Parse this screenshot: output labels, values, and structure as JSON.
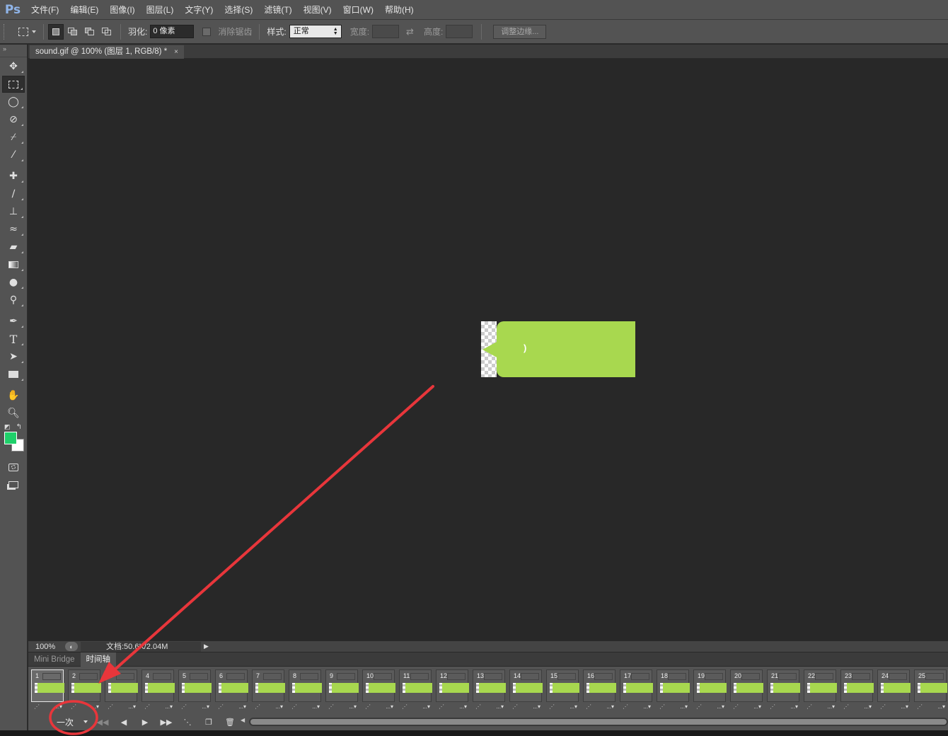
{
  "app": {
    "logo": "Ps"
  },
  "menu": [
    "文件(F)",
    "编辑(E)",
    "图像(I)",
    "图层(L)",
    "文字(Y)",
    "选择(S)",
    "滤镜(T)",
    "视图(V)",
    "窗口(W)",
    "帮助(H)"
  ],
  "options": {
    "feather_label": "羽化:",
    "feather_value": "0 像素",
    "antialias_label": "消除锯齿",
    "style_label": "样式:",
    "style_value": "正常",
    "width_label": "宽度:",
    "height_label": "高度:",
    "refine_edge": "调整边缘..."
  },
  "document": {
    "tab_title": "sound.gif @ 100% (图层 1, RGB/8) *",
    "close_glyph": "×",
    "bubble_glyph": ")"
  },
  "status": {
    "zoom": "100%",
    "docinfo": "文档:50.6K/2.04M"
  },
  "panel_tabs": [
    "Mini Bridge",
    "时间轴"
  ],
  "frames": [
    {
      "num": "1",
      "delay": "..."
    },
    {
      "num": "2",
      "delay": "..."
    },
    {
      "num": "3",
      "delay": "..."
    },
    {
      "num": "4",
      "delay": "..."
    },
    {
      "num": "5",
      "delay": "..."
    },
    {
      "num": "6",
      "delay": "..."
    },
    {
      "num": "7",
      "delay": "..."
    },
    {
      "num": "8",
      "delay": "..."
    },
    {
      "num": "9",
      "delay": "..."
    },
    {
      "num": "10",
      "delay": "..."
    },
    {
      "num": "11",
      "delay": "..."
    },
    {
      "num": "12",
      "delay": "..."
    },
    {
      "num": "13",
      "delay": "..."
    },
    {
      "num": "14",
      "delay": "..."
    },
    {
      "num": "15",
      "delay": "..."
    },
    {
      "num": "16",
      "delay": "..."
    },
    {
      "num": "17",
      "delay": "..."
    },
    {
      "num": "18",
      "delay": "..."
    },
    {
      "num": "19",
      "delay": "..."
    },
    {
      "num": "20",
      "delay": "..."
    },
    {
      "num": "21",
      "delay": "..."
    },
    {
      "num": "22",
      "delay": "..."
    },
    {
      "num": "23",
      "delay": "..."
    },
    {
      "num": "24",
      "delay": "..."
    },
    {
      "num": "25",
      "delay": "..."
    }
  ],
  "timeline": {
    "loop_value": "一次"
  },
  "colors": {
    "foreground": "#1fd06a",
    "background": "#ffffff",
    "bubble": "#a8d84f",
    "annotation": "#e8363b"
  }
}
